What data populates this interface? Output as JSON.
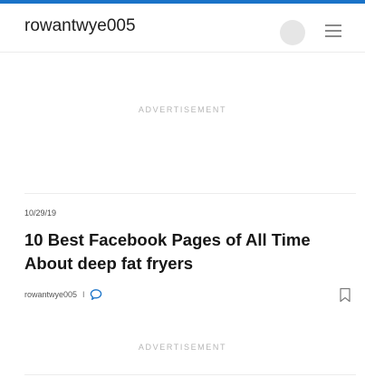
{
  "header": {
    "site_name": "rowantwye005",
    "avatar_icon": "avatar-placeholder",
    "menu_icon": "hamburger-menu-icon"
  },
  "ads": [
    {
      "label": "ADVERTISEMENT"
    },
    {
      "label": "ADVERTISEMENT"
    }
  ],
  "post": {
    "date": "10/29/19",
    "title": "10 Best Facebook Pages of All Time About deep fat fryers",
    "author": "rowantwye005",
    "separator": "I",
    "comment_icon": "comment-bubble-icon",
    "bookmark_icon": "bookmark-icon"
  },
  "colors": {
    "accent": "#1a73c8",
    "text": "#1a1a1a",
    "muted": "#b6b6b6"
  }
}
